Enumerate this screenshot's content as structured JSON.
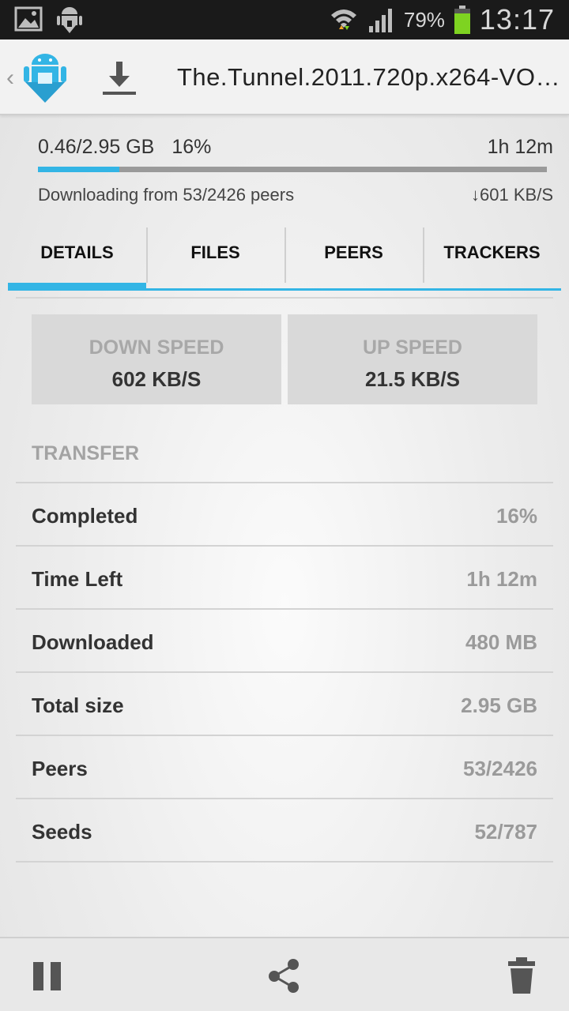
{
  "status_bar": {
    "battery_percent": "79%",
    "time": "13:17",
    "icons": [
      "picture-icon",
      "android-download-icon",
      "wifi-icon",
      "signal-icon",
      "battery-icon"
    ]
  },
  "action_bar": {
    "title": "The.Tunnel.2011.720p.x264-VO…",
    "icons": [
      "app-logo-icon",
      "download-icon"
    ]
  },
  "progress": {
    "size_text": "0.46/2.95 GB",
    "percent_text": "16%",
    "percent_value": 0.16,
    "eta": "1h 12m",
    "status_text": "Downloading from 53/2426 peers",
    "rate_text": "↓601 KB/S"
  },
  "tabs": [
    {
      "label": "DETAILS",
      "active": true
    },
    {
      "label": "FILES",
      "active": false
    },
    {
      "label": "PEERS",
      "active": false
    },
    {
      "label": "TRACKERS",
      "active": false
    }
  ],
  "speeds": {
    "down_label": "DOWN SPEED",
    "down_value": "602 KB/S",
    "up_label": "UP SPEED",
    "up_value": "21.5 KB/S"
  },
  "transfer": {
    "header": "TRANSFER",
    "rows": [
      {
        "key": "Completed",
        "value": "16%"
      },
      {
        "key": "Time Left",
        "value": "1h 12m"
      },
      {
        "key": "Downloaded",
        "value": "480 MB"
      },
      {
        "key": "Total size",
        "value": "2.95 GB"
      },
      {
        "key": "Peers",
        "value": "53/2426"
      },
      {
        "key": "Seeds",
        "value": "52/787"
      }
    ]
  },
  "bottom_bar": {
    "icons": [
      "pause-icon",
      "share-icon",
      "delete-icon"
    ]
  },
  "colors": {
    "accent": "#33b5e5",
    "status_bar_bg": "#1a1a1a",
    "battery": "#7ed321"
  }
}
